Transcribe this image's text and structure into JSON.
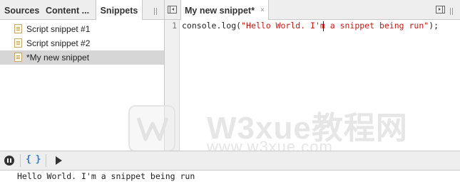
{
  "navigator": {
    "tabs": [
      "Sources",
      "Content ...",
      "Snippets"
    ],
    "active_tab": "Snippets",
    "snippets": [
      {
        "label": "Script snippet #1",
        "selected": false
      },
      {
        "label": "Script snippet #2",
        "selected": false
      },
      {
        "label": "*My new snippet",
        "selected": true
      }
    ]
  },
  "editor": {
    "tab_label": "My new snippet*",
    "tab_close": "×",
    "line_number": "1",
    "code": {
      "prefix": "console.log(",
      "string": "\"Hello World. I'm a snippet being run\"",
      "suffix": ");"
    }
  },
  "watermark": {
    "title": "W3xue教程网",
    "url": "www.w3xue.com"
  },
  "toolbar": {
    "pretty_print_label": "{ }"
  },
  "console": {
    "output": "Hello World. I'm a snippet being run"
  },
  "colors": {
    "string": "#c41a16",
    "pretty_print": "#2f7bd3",
    "selected_row": "#d6d6d6"
  }
}
